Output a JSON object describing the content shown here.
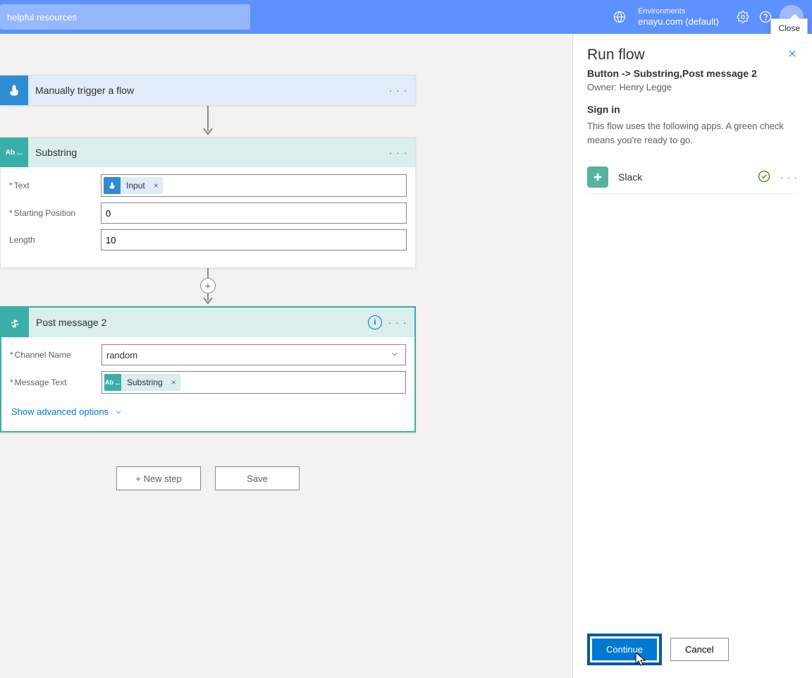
{
  "topbar": {
    "search_placeholder": "helpful resources",
    "env_label": "Environments",
    "env_name": "enayu.com (default)",
    "tooltip": "Close"
  },
  "trigger_card": {
    "title": "Manually trigger a flow"
  },
  "substring_card": {
    "title": "Substring",
    "icon_text": "Ab ...",
    "labels": {
      "text": "Text",
      "start": "Starting Position",
      "length": "Length"
    },
    "token_input": "Input",
    "start_value": "0",
    "length_value": "10"
  },
  "postmsg_card": {
    "title": "Post message 2",
    "labels": {
      "channel": "Channel Name",
      "message": "Message Text"
    },
    "channel_value": "random",
    "token_substring": "Substring",
    "token_icon_text": "Ab ...",
    "advanced": "Show advanced options"
  },
  "footer": {
    "new_step": "+ New step",
    "save": "Save"
  },
  "panel": {
    "title": "Run flow",
    "subtitle": "Button -> Substring,Post message 2",
    "owner": "Owner: Henry Legge",
    "signin_title": "Sign in",
    "signin_desc": "This flow uses the following apps. A green check means you're ready to go.",
    "conn_name": "Slack",
    "continue": "Continue",
    "cancel": "Cancel"
  }
}
